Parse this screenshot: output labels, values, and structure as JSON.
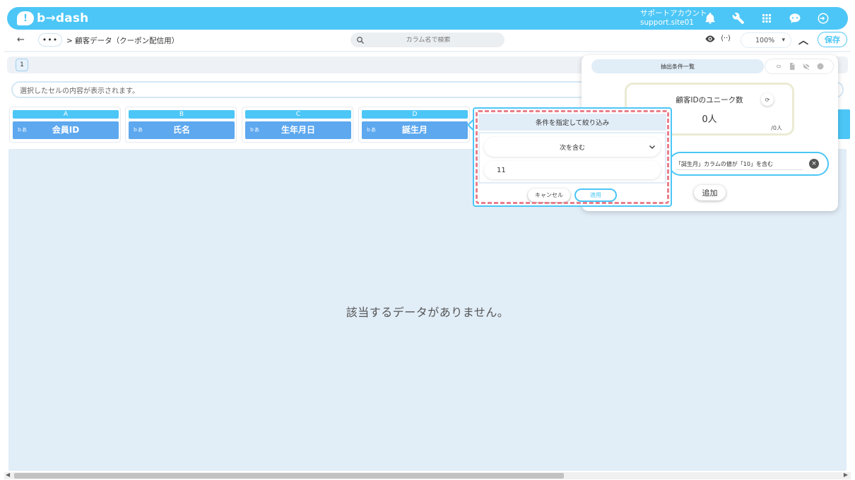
{
  "header": {
    "logo_mark": "!",
    "logo_text": "b→dash",
    "account_label": "サポートアカウント",
    "account_id": "support.site01",
    "icons": [
      "bell-icon",
      "wrench-icon",
      "grid-icon",
      "chat-bot-icon",
      "logout-icon"
    ]
  },
  "nav": {
    "back": "←",
    "more": "•••",
    "breadcrumb": "> 顧客データ（クーポン配信用）",
    "search_placeholder": "カラム名で検索",
    "code_label": "⟨··⟩",
    "zoom": "100%",
    "save_label": "保存"
  },
  "sheet": {
    "tab_label": "1",
    "cell_placeholder": "選択したセルの内容が表示されます。"
  },
  "columns": [
    {
      "letter": "A",
      "type": "ｂあ",
      "name": "会員ID"
    },
    {
      "letter": "B",
      "type": "ｂあ",
      "name": "氏名"
    },
    {
      "letter": "C",
      "type": "ｂあ",
      "name": "生年月日"
    },
    {
      "letter": "D",
      "type": "ｂあ",
      "name": "誕生月"
    }
  ],
  "empty_message": "該当するデータがありません。",
  "extract": {
    "tab_label": "抽出条件一覧",
    "unique_title": "顧客IDのユニーク数",
    "unique_value": "0人",
    "unique_total": "/0人",
    "condition_text": "「誕生月」カラムの値が「10」を含む",
    "add_label": "追加"
  },
  "filter": {
    "title": "条件を指定して絞り込み",
    "operator": "次を含む",
    "value": "11",
    "cancel_label": "キャンセル",
    "apply_label": "適用"
  },
  "colors": {
    "brand": "#4cc6f6",
    "column_header": "#5da8ef",
    "highlight_dash": "#e87f8b",
    "empty_bg": "#e1edf7"
  }
}
